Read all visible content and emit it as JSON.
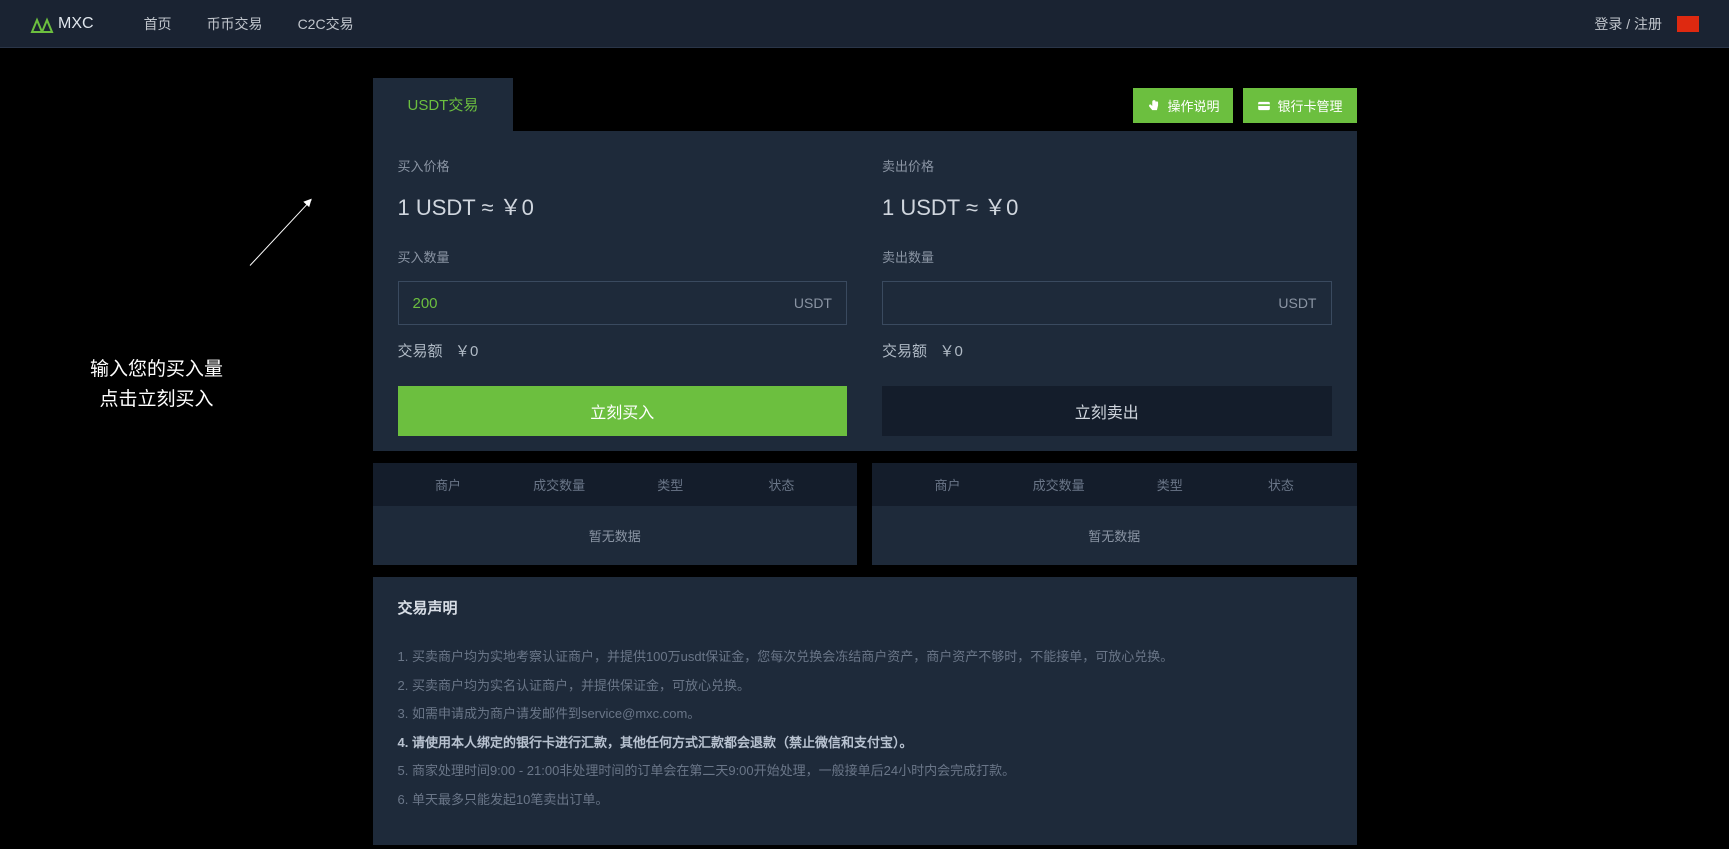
{
  "header": {
    "brand": "MXC",
    "nav": [
      "首页",
      "币币交易",
      "C2C交易"
    ],
    "login": "登录 / 注册"
  },
  "annotation": {
    "line1": "输入您的买入量",
    "line2": "点击立刻买入"
  },
  "tab": "USDT交易",
  "actions": {
    "explain": "操作说明",
    "bank": "银行卡管理"
  },
  "buy": {
    "price_label": "买入价格",
    "price_value": "1 USDT ≈ ￥0",
    "qty_label": "买入数量",
    "qty_value": "200",
    "unit": "USDT",
    "amount_label": "交易额",
    "amount_value": "￥0",
    "button": "立刻买入"
  },
  "sell": {
    "price_label": "卖出价格",
    "price_value": "1 USDT ≈ ￥0",
    "qty_label": "卖出数量",
    "qty_value": "",
    "unit": "USDT",
    "amount_label": "交易额",
    "amount_value": "￥0",
    "button": "立刻卖出"
  },
  "table": {
    "headers": [
      "商户",
      "成交数量",
      "类型",
      "状态"
    ],
    "empty": "暂无数据"
  },
  "declaration": {
    "title": "交易声明",
    "items": [
      "1. 买卖商户均为实地考察认证商户，并提供100万usdt保证金，您每次兑换会冻结商户资产，商户资产不够时，不能接单，可放心兑换。",
      "2. 买卖商户均为实名认证商户，并提供保证金，可放心兑换。",
      "3. 如需申请成为商户请发邮件到service@mxc.com。",
      "4. 请使用本人绑定的银行卡进行汇款，其他任何方式汇款都会退款（禁止微信和支付宝）。",
      "5. 商家处理时间9:00 - 21:00非处理时间的订单会在第二天9:00开始处理，一般接单后24小时内会完成打款。",
      "6. 单天最多只能发起10笔卖出订单。"
    ],
    "bold_index": 3
  }
}
